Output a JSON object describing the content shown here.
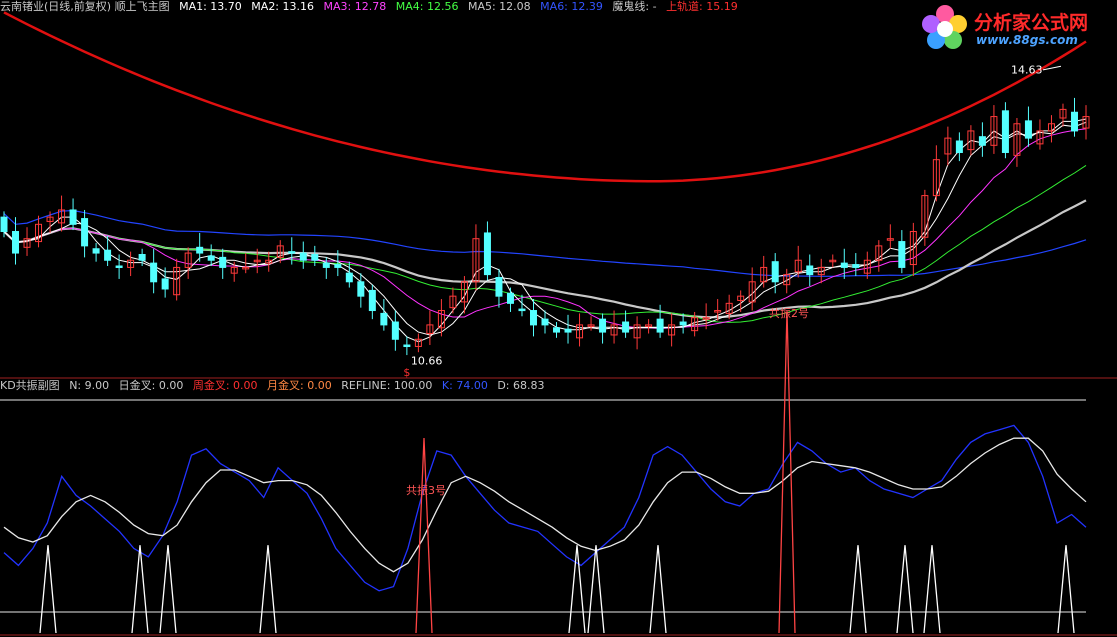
{
  "header": {
    "items": [
      {
        "text": "云南锗业(日线,前复权) 顺上飞主图",
        "color": "#c8c8c8"
      },
      {
        "text": "MA1: 13.70",
        "color": "#ffffff"
      },
      {
        "text": "MA2: 13.16",
        "color": "#ffffff"
      },
      {
        "text": "MA3: 12.78",
        "color": "#ff44ff"
      },
      {
        "text": "MA4: 12.56",
        "color": "#44ff44"
      },
      {
        "text": "MA5: 12.08",
        "color": "#c8c8c8"
      },
      {
        "text": "MA6: 12.39",
        "color": "#3355ff"
      },
      {
        "text": "魔鬼线: -",
        "color": "#c8c8c8"
      },
      {
        "text": "上轨道: 15.19",
        "color": "#ff3030"
      }
    ]
  },
  "subheader": {
    "items": [
      {
        "text": "KD共振副图",
        "color": "#c8c8c8"
      },
      {
        "text": "N: 9.00",
        "color": "#c8c8c8"
      },
      {
        "text": "日金叉: 0.00",
        "color": "#c8c8c8"
      },
      {
        "text": "周金叉: 0.00",
        "color": "#ff3030"
      },
      {
        "text": "月金叉: 0.00",
        "color": "#ff8844"
      },
      {
        "text": "REFLINE: 100.00",
        "color": "#c8c8c8"
      },
      {
        "text": "K: 74.00",
        "color": "#3355ff"
      },
      {
        "text": "D: 68.83",
        "color": "#c8c8c8"
      }
    ]
  },
  "logo": {
    "title": "分析家公式网",
    "url": "www.88gs.com"
  },
  "chart_data": [
    {
      "type": "candlestick",
      "annotations": {
        "high_label": "14.63",
        "low_label": "10.66",
        "marker": "$"
      },
      "colors": {
        "up": "#ff3a3a",
        "down": "#54ffff",
        "ma_white": "#ffffff",
        "ma_magenta": "#ff33ff",
        "ma_green": "#33ee33",
        "ma_gray": "#c8c8c8",
        "ma_blue": "#2244ff",
        "upper_rail": "#e01010"
      },
      "close": [
        12.3,
        12.0,
        12.2,
        12.4,
        12.5,
        12.6,
        12.4,
        12.1,
        12.0,
        11.9,
        11.8,
        11.9,
        11.9,
        11.6,
        11.5,
        11.8,
        12.0,
        12.0,
        11.9,
        11.8,
        11.8,
        11.8,
        11.9,
        11.9,
        12.1,
        12.0,
        11.9,
        11.9,
        11.8,
        11.8,
        11.6,
        11.4,
        11.2,
        11.0,
        10.8,
        10.7,
        10.8,
        11.0,
        11.2,
        11.4,
        11.6,
        12.2,
        11.7,
        11.4,
        11.3,
        11.2,
        11.0,
        11.0,
        10.9,
        10.9,
        11.0,
        11.0,
        10.9,
        11.0,
        10.9,
        11.0,
        11.0,
        10.9,
        11.0,
        11.0,
        11.1,
        11.1,
        11.2,
        11.3,
        11.4,
        11.6,
        11.8,
        11.6,
        11.7,
        11.9,
        11.7,
        11.8,
        11.9,
        11.8,
        11.8,
        11.9,
        12.1,
        12.2,
        11.8,
        12.3,
        12.8,
        13.3,
        13.6,
        13.4,
        13.7,
        13.5,
        13.9,
        13.4,
        13.8,
        13.6,
        13.7,
        13.8,
        14.0,
        13.7,
        13.9
      ]
    },
    {
      "type": "line",
      "ylim": [
        0,
        100
      ],
      "refline": 100,
      "series": [
        {
          "name": "K",
          "color": "#2233ff",
          "values": [
            28,
            22,
            30,
            42,
            64,
            55,
            50,
            44,
            38,
            30,
            26,
            36,
            52,
            74,
            77,
            70,
            66,
            62,
            54,
            68,
            62,
            56,
            44,
            30,
            22,
            14,
            10,
            12,
            30,
            56,
            76,
            74,
            64,
            56,
            48,
            42,
            40,
            38,
            32,
            26,
            22,
            28,
            34,
            40,
            54,
            74,
            78,
            74,
            66,
            58,
            52,
            50,
            56,
            58,
            70,
            80,
            76,
            70,
            66,
            68,
            62,
            58,
            56,
            54,
            58,
            62,
            72,
            80,
            84,
            86,
            88,
            80,
            64,
            42,
            46,
            40
          ]
        },
        {
          "name": "D",
          "color": "#e8e8e8",
          "values": [
            40,
            35,
            33,
            36,
            45,
            52,
            55,
            52,
            47,
            41,
            37,
            36,
            41,
            52,
            61,
            67,
            67,
            64,
            61,
            62,
            62,
            60,
            55,
            47,
            38,
            30,
            23,
            19,
            23,
            34,
            48,
            61,
            64,
            61,
            57,
            52,
            48,
            44,
            40,
            35,
            31,
            29,
            31,
            34,
            41,
            52,
            61,
            66,
            66,
            63,
            59,
            56,
            56,
            57,
            62,
            68,
            71,
            70,
            69,
            68,
            66,
            63,
            60,
            58,
            58,
            59,
            64,
            70,
            75,
            79,
            82,
            82,
            76,
            65,
            58,
            52
          ]
        }
      ],
      "spikes": [
        {
          "label": "",
          "height": 18,
          "color": "#ffffff"
        },
        {
          "label": "",
          "height": 18,
          "color": "#ffffff"
        },
        {
          "label": "",
          "height": 18,
          "color": "#ffffff"
        },
        {
          "label": "",
          "height": 18,
          "color": "#ffffff"
        },
        {
          "label": "共振3号",
          "height": 40,
          "color": "#ff4444"
        },
        {
          "label": "",
          "height": 18,
          "color": "#ffffff"
        },
        {
          "label": "",
          "height": 18,
          "color": "#ffffff"
        },
        {
          "label": "",
          "height": 18,
          "color": "#ffffff"
        },
        {
          "label": "共振2号",
          "height": 66,
          "color": "#ff4444"
        },
        {
          "label": "",
          "height": 18,
          "color": "#ffffff"
        },
        {
          "label": "",
          "height": 18,
          "color": "#ffffff"
        },
        {
          "label": "",
          "height": 18,
          "color": "#ffffff"
        },
        {
          "label": "",
          "height": 18,
          "color": "#ffffff"
        }
      ]
    }
  ]
}
